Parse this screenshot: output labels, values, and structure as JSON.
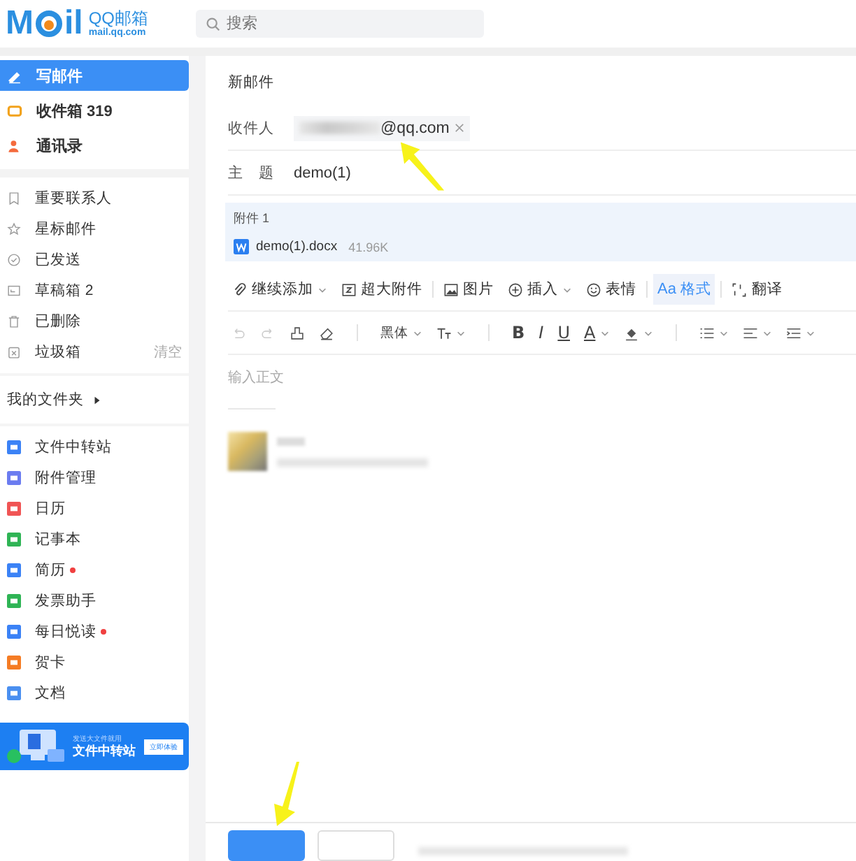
{
  "header": {
    "logo": {
      "part_1": "M",
      "part_2": "il",
      "name": "QQ邮箱",
      "domain": "mail.qq.com"
    },
    "search": {
      "placeholder": "搜索"
    }
  },
  "sidebar": {
    "primary": [
      {
        "label": "写邮件",
        "selected": true
      },
      {
        "label": "收件箱",
        "count": "319",
        "selected": false
      },
      {
        "label": "通讯录",
        "selected": false
      }
    ],
    "folders": [
      {
        "label": "重要联系人"
      },
      {
        "label": "星标邮件"
      },
      {
        "label": "已发送"
      },
      {
        "label": "草稿箱",
        "count": "2"
      },
      {
        "label": "已删除"
      },
      {
        "label": "垃圾箱",
        "action": "清空"
      }
    ],
    "my_folders": {
      "label": "我的文件夹",
      "expanded": false
    },
    "apps": [
      {
        "label": "文件中转站",
        "color": "#3b82f6",
        "unread": false
      },
      {
        "label": "附件管理",
        "color": "#6b7cf0",
        "unread": false
      },
      {
        "label": "日历",
        "color": "#f05454",
        "unread": false
      },
      {
        "label": "记事本",
        "color": "#2fb455",
        "unread": false
      },
      {
        "label": "简历",
        "color": "#3b82f6",
        "unread": true
      },
      {
        "label": "发票助手",
        "color": "#2fb455",
        "unread": false
      },
      {
        "label": "每日悦读",
        "color": "#3b82f6",
        "unread": true
      },
      {
        "label": "贺卡",
        "color": "#f57c24",
        "unread": false
      },
      {
        "label": "文档",
        "color": "#4a8ff0",
        "unread": false
      }
    ],
    "banner": {
      "caption": "发送大文件就用",
      "title": "文件中转站",
      "button": "立即体验"
    }
  },
  "compose": {
    "title": "新邮件",
    "to_label": "收件人",
    "recipient": {
      "visible_part": "@qq.com"
    },
    "subject_label": "主　题",
    "subject": "demo(1)",
    "attachments": {
      "title": "附件 1",
      "files": [
        {
          "name": "demo(1).docx",
          "size": "41.96K"
        }
      ]
    },
    "toolbar": [
      {
        "label": "继续添加",
        "selected": false
      },
      {
        "label": "超大附件",
        "selected": false
      },
      {
        "label": "图片",
        "selected": false
      },
      {
        "label": "插入",
        "selected": false
      },
      {
        "label": "表情",
        "selected": false
      },
      {
        "label": "格式",
        "prefix": "Aa",
        "selected": true
      },
      {
        "label": "翻译",
        "selected": false
      }
    ],
    "format_bar": {
      "undo": {
        "disabled": true
      },
      "redo": {
        "disabled": true
      },
      "font": "黑体",
      "chars": [
        "B",
        "I",
        "U",
        "A"
      ]
    },
    "body": {
      "placeholder": "输入正文"
    }
  }
}
